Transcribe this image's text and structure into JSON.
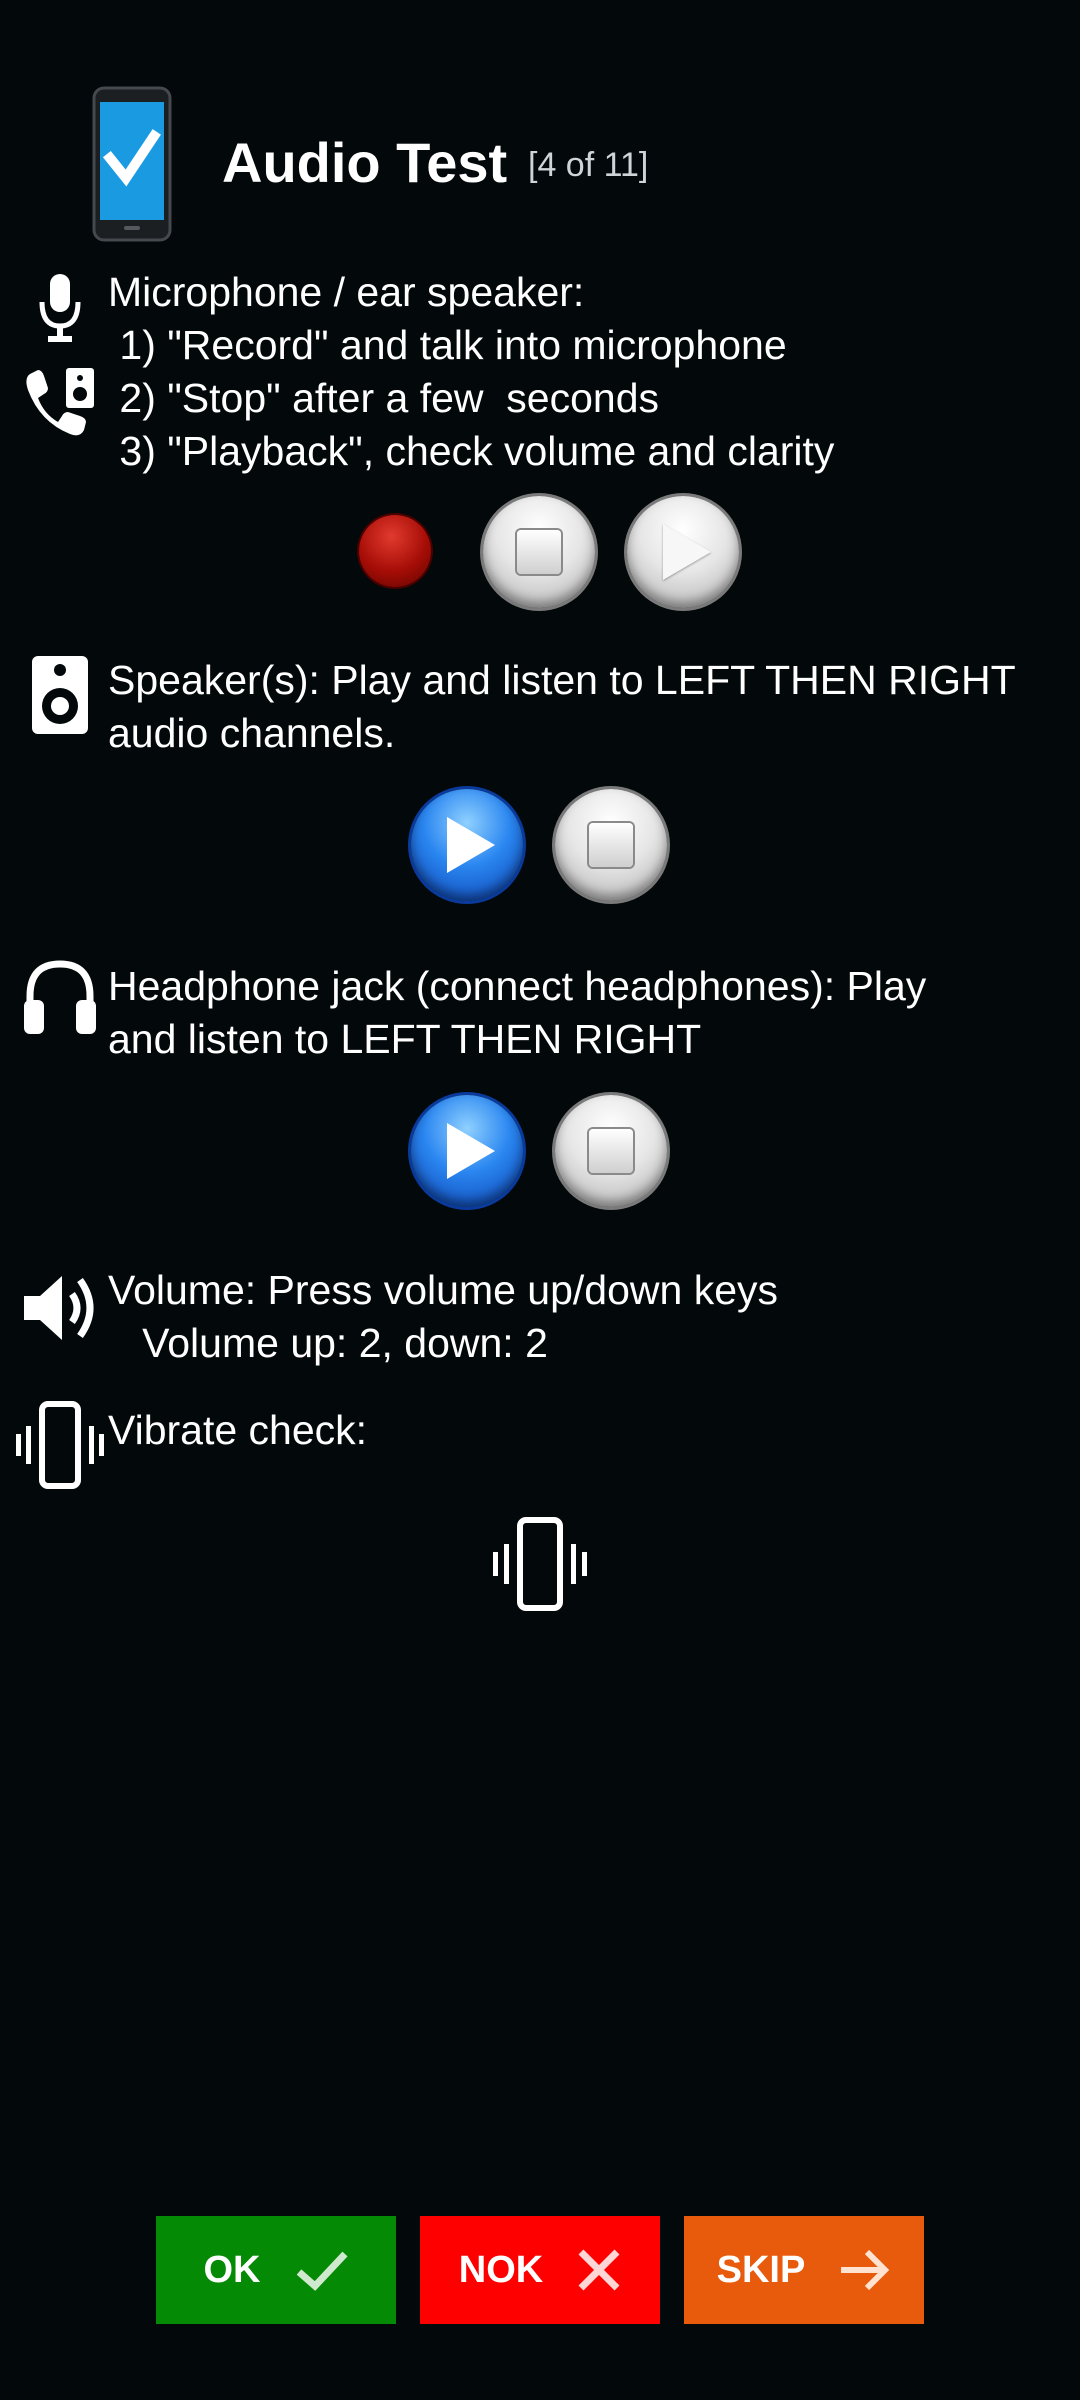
{
  "header": {
    "title": "Audio Test",
    "counter": "[4 of 11]",
    "logo_icon": "phone-check-icon"
  },
  "sections": {
    "microphone": {
      "lines": [
        "Microphone / ear speaker:",
        " 1) \"Record\" and talk into microphone",
        " 2) \"Stop\" after a few  seconds",
        " 3) \"Playback\", check volume and clarity"
      ],
      "icons": [
        "microphone-icon",
        "phone-speaker-icon"
      ],
      "buttons": [
        "record",
        "stop",
        "playback"
      ]
    },
    "speaker": {
      "lines": [
        "Speaker(s): Play and listen to LEFT THEN RIGHT",
        "audio channels."
      ],
      "icon": "speaker-icon",
      "buttons": [
        "play",
        "stop"
      ]
    },
    "headphone": {
      "lines": [
        "Headphone jack (connect headphones): Play",
        "and listen to LEFT THEN RIGHT"
      ],
      "icon": "headphones-icon",
      "buttons": [
        "play",
        "stop"
      ]
    },
    "volume": {
      "lines": [
        "Volume: Press volume up/down keys",
        "   Volume up: 2, down: 2"
      ],
      "icon": "volume-icon"
    },
    "vibrate": {
      "label": "Vibrate check:",
      "icon": "vibrate-icon",
      "button_icon": "vibrate-icon"
    }
  },
  "actions": {
    "ok": {
      "label": "OK",
      "icon": "check-icon",
      "color": "#058a05"
    },
    "nok": {
      "label": "NOK",
      "icon": "close-icon",
      "color": "#ff0000"
    },
    "skip": {
      "label": "SKIP",
      "icon": "arrow-right-icon",
      "color": "#e85a0c"
    }
  },
  "colors": {
    "background": "#03080b",
    "play_blue": "#2a86f0",
    "record_red": "#a50d06"
  }
}
